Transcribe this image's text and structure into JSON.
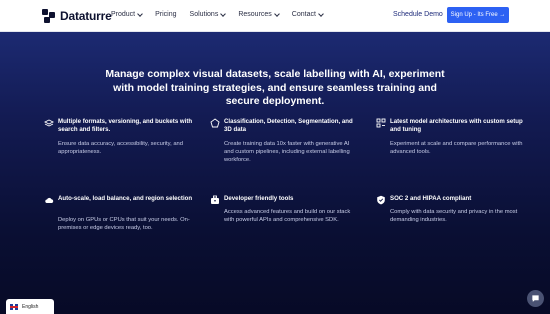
{
  "header": {
    "brand": "Dataturre",
    "nav": [
      {
        "label": "Product",
        "dropdown": true
      },
      {
        "label": "Pricing",
        "dropdown": false
      },
      {
        "label": "Solutions",
        "dropdown": true
      },
      {
        "label": "Resources",
        "dropdown": true
      },
      {
        "label": "Contact",
        "dropdown": true
      }
    ],
    "schedule_demo": "Schedule Demo",
    "signup": "Sign Up - Its Free →"
  },
  "hero": {
    "headline": "Manage complex visual datasets, scale labelling with AI, experiment with model training strategies, and ensure seamless training and secure deployment."
  },
  "features": [
    {
      "icon": "layers-icon",
      "title": "Multiple formats, versioning, and buckets with search and filters.",
      "desc": "Ensure data accuracy, accessibility, security, and appropriateness."
    },
    {
      "icon": "shapes-icon",
      "title": "Classification, Detection, Segmentation, and 3D data",
      "desc": "Create training data 10x faster with generative AI and custom pipelines, including external labelling workforce."
    },
    {
      "icon": "model-icon",
      "title": "Latest model architectures with custom setup and tuning",
      "desc": "Experiment at scale and compare performance with advanced tools."
    },
    {
      "icon": "cloud-icon",
      "title": "Auto-scale, load balance, and region selection",
      "desc": "Deploy on GPUs or CPUs that suit your needs. On-premises or edge devices ready, too."
    },
    {
      "icon": "toolbox-icon",
      "title": "Developer friendly tools",
      "desc": "Access advanced features and build on our stack with powerful APIs and comprehensive SDK."
    },
    {
      "icon": "shield-icon",
      "title": "SOC 2 and HIPAA compliant",
      "desc": "Comply with data security and privacy in the most demanding industries."
    }
  ],
  "language": {
    "label": "English",
    "flag": "uk-flag-icon"
  },
  "chat": {
    "icon": "chat-icon"
  },
  "colors": {
    "accent": "#2d61f3",
    "hero_top": "#1c2a72",
    "hero_bottom": "#070a26"
  }
}
